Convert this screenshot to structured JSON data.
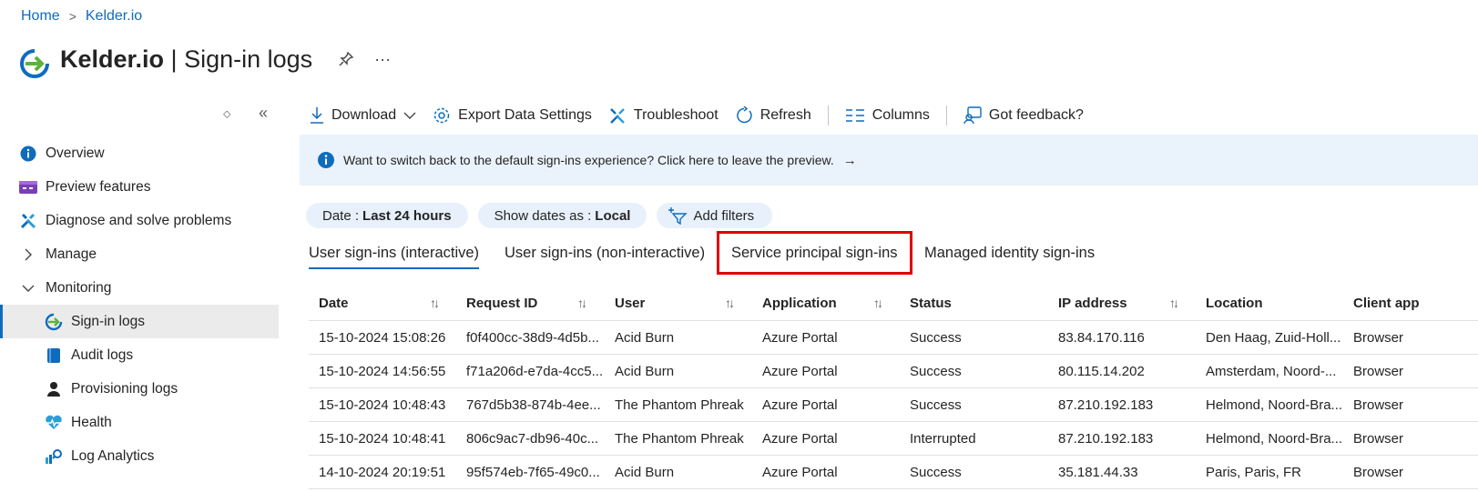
{
  "breadcrumb": {
    "home": "Home",
    "sep": ">",
    "current": "Kelder.io"
  },
  "title": {
    "org": "Kelder.io",
    "divider": " | ",
    "page": "Sign-in logs",
    "pin_icon": "pin-icon",
    "more": "···"
  },
  "sidebar": {
    "updown_icon": "⬦",
    "collapse_icon": "«",
    "items": [
      {
        "label": "Overview",
        "icon": "info-icon"
      },
      {
        "label": "Preview features",
        "icon": "preview-icon"
      },
      {
        "label": "Diagnose and solve problems",
        "icon": "wrench-icon"
      },
      {
        "label": "Manage",
        "icon": "chevron-right-icon"
      },
      {
        "label": "Monitoring",
        "icon": "chevron-down-icon"
      },
      {
        "label": "Sign-in logs",
        "icon": "signin-icon",
        "active": true
      },
      {
        "label": "Audit logs",
        "icon": "book-icon"
      },
      {
        "label": "Provisioning logs",
        "icon": "person-icon"
      },
      {
        "label": "Health",
        "icon": "heart-pulse-icon"
      },
      {
        "label": "Log Analytics",
        "icon": "analytics-icon"
      }
    ]
  },
  "toolbar": {
    "download": "Download",
    "export": "Export Data Settings",
    "troubleshoot": "Troubleshoot",
    "refresh": "Refresh",
    "columns": "Columns",
    "feedback": "Got feedback?"
  },
  "banner": {
    "message": "Want to switch back to the default sign-ins experience? Click here to leave the preview.",
    "arrow": "→"
  },
  "filters": {
    "date_label": "Date :",
    "date_value": "Last 24 hours",
    "show_label": "Show dates as :",
    "show_value": "Local",
    "add": "Add filters"
  },
  "tabs": [
    {
      "label": "User sign-ins (interactive)",
      "active": true
    },
    {
      "label": "User sign-ins (non-interactive)"
    },
    {
      "label": "Service principal sign-ins",
      "highlighted": true
    },
    {
      "label": "Managed identity sign-ins"
    }
  ],
  "table": {
    "columns": [
      "Date",
      "Request ID",
      "User",
      "Application",
      "Status",
      "IP address",
      "Location",
      "Client app"
    ],
    "sort_icon": "↑↓",
    "rows": [
      [
        "15-10-2024 15:08:26",
        "f0f400cc-38d9-4d5b...",
        "Acid Burn",
        "Azure Portal",
        "Success",
        "83.84.170.116",
        "Den Haag, Zuid-Holl...",
        "Browser"
      ],
      [
        "15-10-2024 14:56:55",
        "f71a206d-e7da-4cc5...",
        "Acid Burn",
        "Azure Portal",
        "Success",
        "80.115.14.202",
        "Amsterdam, Noord-...",
        "Browser"
      ],
      [
        "15-10-2024 10:48:43",
        "767d5b38-874b-4ee...",
        "The Phantom Phreak",
        "Azure Portal",
        "Success",
        "87.210.192.183",
        "Helmond, Noord-Bra...",
        "Browser"
      ],
      [
        "15-10-2024 10:48:41",
        "806c9ac7-db96-40c...",
        "The Phantom Phreak",
        "Azure Portal",
        "Interrupted",
        "87.210.192.183",
        "Helmond, Noord-Bra...",
        "Browser"
      ],
      [
        "14-10-2024 20:19:51",
        "95f574eb-7f65-49c0...",
        "Acid Burn",
        "Azure Portal",
        "Success",
        "35.181.44.33",
        "Paris, Paris, FR",
        "Browser"
      ]
    ]
  },
  "colors": {
    "accent": "#0f6cbd",
    "banner_bg": "#eaf3fc",
    "highlight": "#e00000",
    "pill_bg": "#e8f1fb"
  }
}
